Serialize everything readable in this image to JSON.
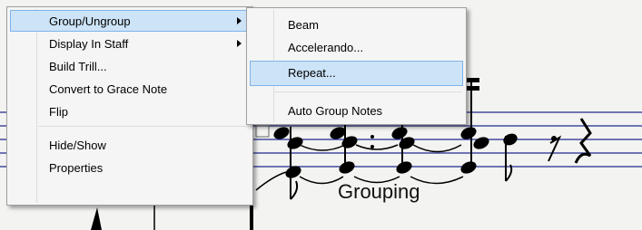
{
  "score": {
    "annotation": "Grouping"
  },
  "main_menu": {
    "items": [
      {
        "label": "Group/Ungroup",
        "has_submenu": true,
        "highlighted": true
      },
      {
        "label": "Display In Staff",
        "has_submenu": true
      },
      {
        "label": "Build Trill..."
      },
      {
        "label": "Convert to Grace Note"
      },
      {
        "label": "Flip"
      },
      {
        "label": "Hide/Show"
      },
      {
        "label": "Properties"
      }
    ]
  },
  "sub_menu": {
    "items": [
      {
        "label": "Beam"
      },
      {
        "label": "Accelerando..."
      },
      {
        "label": "Repeat...",
        "highlighted": true
      },
      {
        "label": "Auto Group Notes"
      }
    ]
  },
  "colors": {
    "highlight_fill": "#cde3f7",
    "highlight_border": "#7eb4ea",
    "staff_line": "#1e2a8c"
  }
}
